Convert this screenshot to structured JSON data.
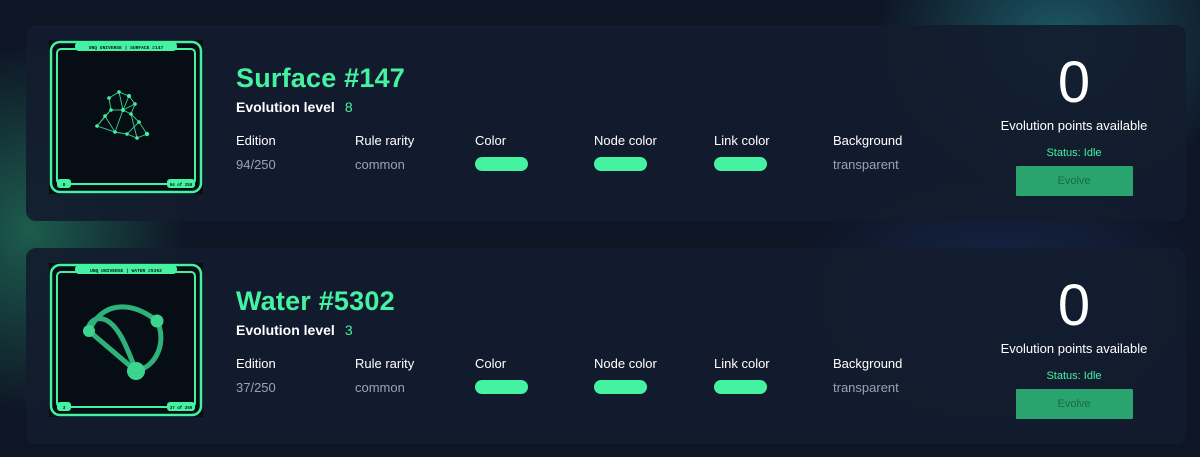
{
  "cards": [
    {
      "thumbnail": {
        "header": "UNQ UNIVERSE | SURFACE #147",
        "footer_left": "8",
        "footer_right": "94 of 250"
      },
      "title": "Surface #147",
      "evolution_label": "Evolution level",
      "evolution_level": "8",
      "attributes": {
        "edition": {
          "label": "Edition",
          "value": "94/250"
        },
        "rule_rarity": {
          "label": "Rule rarity",
          "value": "common"
        },
        "color": {
          "label": "Color",
          "swatch": "#45f2a2"
        },
        "node_color": {
          "label": "Node color",
          "swatch": "#45f2a2"
        },
        "link_color": {
          "label": "Link color",
          "swatch": "#45f2a2"
        },
        "background": {
          "label": "Background",
          "value": "transparent"
        }
      },
      "points": {
        "value": "0",
        "caption": "Evolution points available",
        "status": "Status: Idle",
        "button": "Evolve"
      }
    },
    {
      "thumbnail": {
        "header": "UNQ UNIVERSE | WATER #5302",
        "footer_left": "3",
        "footer_right": "37 of 250"
      },
      "title": "Water #5302",
      "evolution_label": "Evolution level",
      "evolution_level": "3",
      "attributes": {
        "edition": {
          "label": "Edition",
          "value": "37/250"
        },
        "rule_rarity": {
          "label": "Rule rarity",
          "value": "common"
        },
        "color": {
          "label": "Color",
          "swatch": "#45f2a2"
        },
        "node_color": {
          "label": "Node color",
          "swatch": "#45f2a2"
        },
        "link_color": {
          "label": "Link color",
          "swatch": "#45f2a2"
        },
        "background": {
          "label": "Background",
          "value": "transparent"
        }
      },
      "points": {
        "value": "0",
        "caption": "Evolution points available",
        "status": "Status: Idle",
        "button": "Evolve"
      }
    }
  ],
  "colors": {
    "accent": "#45f2a2",
    "button": "#2aa46e",
    "card": "#121c2e",
    "page": "#0e1626"
  }
}
